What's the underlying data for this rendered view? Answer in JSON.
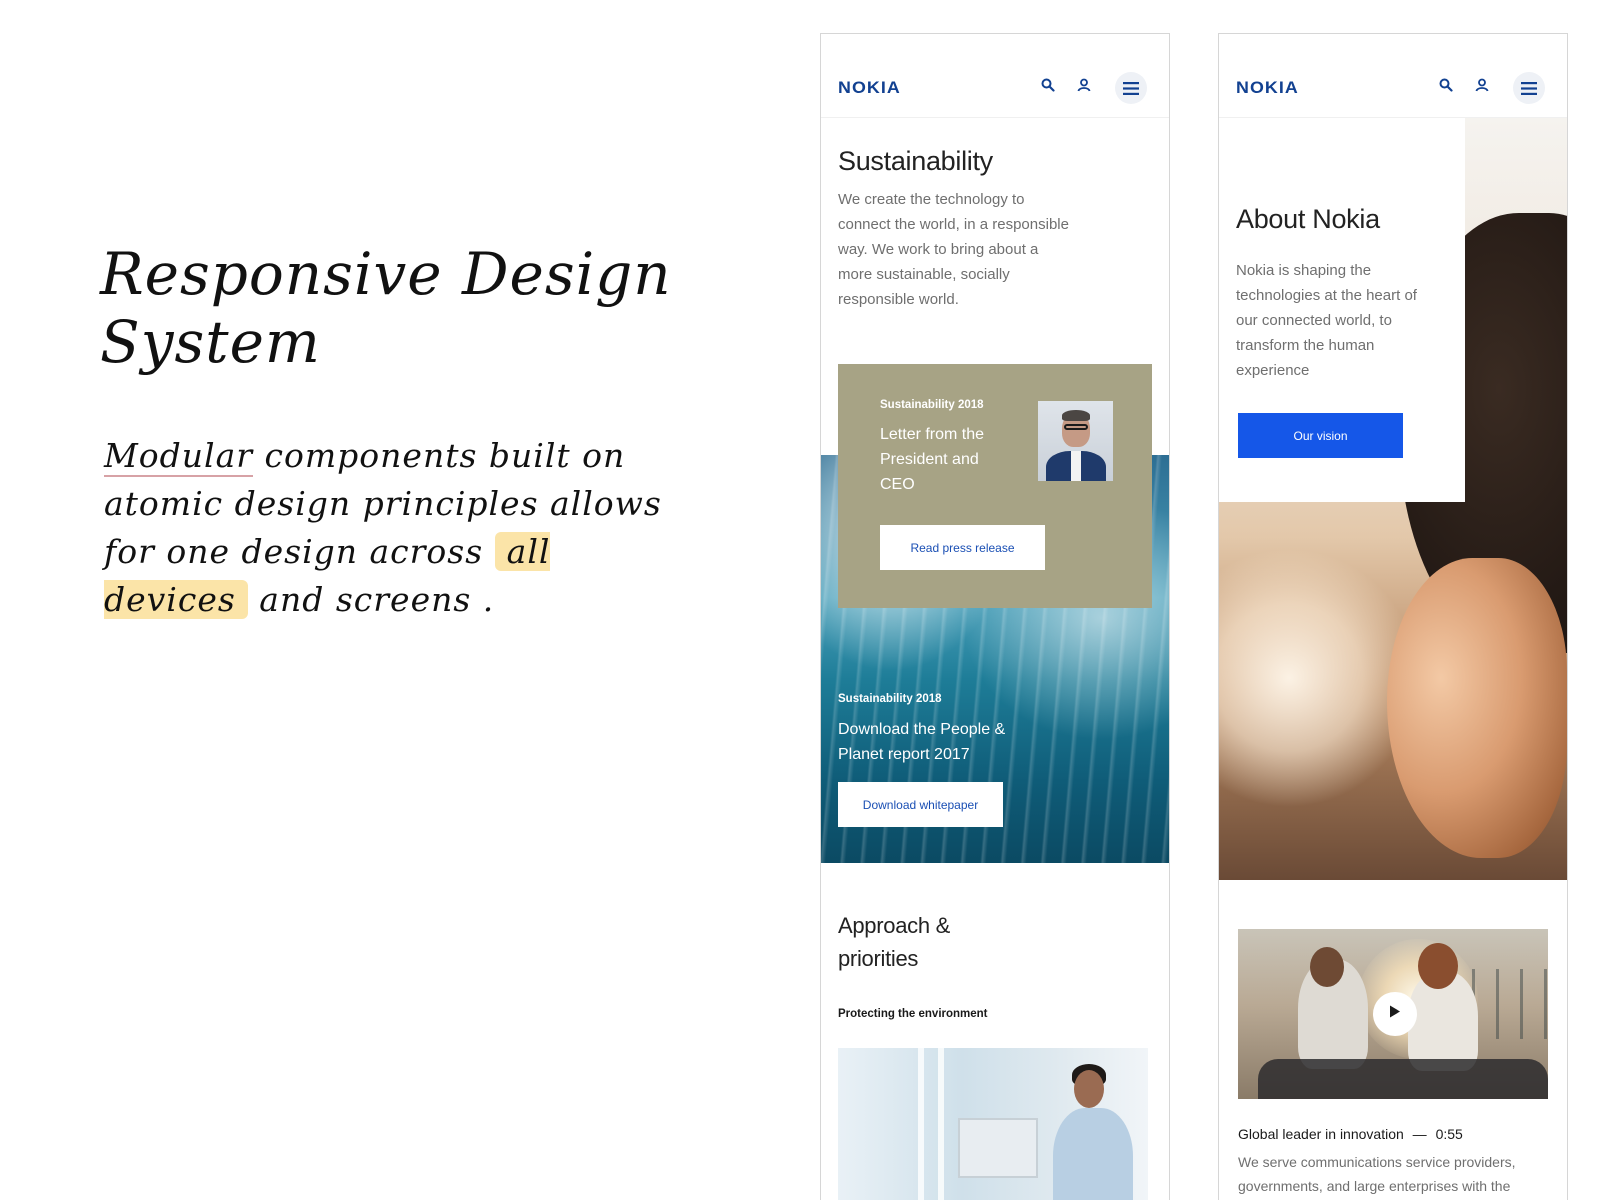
{
  "notes": {
    "title_line1": "Responsive Design",
    "title_line2": "System",
    "sub_part1": "Modular",
    "sub_part2": " components built on atomic design principles allows for one design across ",
    "sub_highlight": "all devices",
    "sub_part3": " and screens ."
  },
  "phone_a": {
    "logo": "NOKIA",
    "intro_title": "Sustainability",
    "intro_body": "We create the technology to connect the world, in a responsible way. We work to bring about a more sustainable, socially responsible world.",
    "letter_card": {
      "kicker": "Sustainability 2018",
      "title": "Letter from the President and CEO",
      "button": "Read press release"
    },
    "report_card": {
      "kicker": "Sustainability 2018",
      "title": "Download the People & Planet report 2017",
      "button": "Download whitepaper"
    },
    "approach_title": "Approach & priorities",
    "approach_kicker": "Protecting the environment"
  },
  "phone_b": {
    "logo": "NOKIA",
    "about_title": "About Nokia",
    "about_body": "Nokia is shaping the technologies at the heart of our connected world, to transform the human experience",
    "about_button": "Our vision",
    "video_title": "Global leader in innovation",
    "video_separator": "—",
    "video_duration": "0:55",
    "video_desc": "We serve communications service providers, governments, and large enterprises with the"
  },
  "colors": {
    "brand_blue": "#124191",
    "button_blue": "#1557e8",
    "olive_card": "#a7a385",
    "highlight": "#fbe4a8"
  },
  "icons": [
    "search-icon",
    "user-icon",
    "menu-icon",
    "play-icon"
  ]
}
